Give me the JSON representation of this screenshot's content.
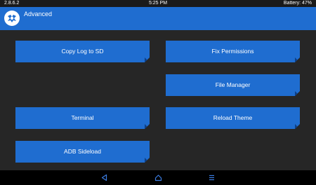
{
  "status": {
    "version": "2.8.6.2",
    "time": "5:25 PM",
    "battery": "Battery: 47%"
  },
  "header": {
    "title": "Advanced",
    "logo_icon": "twrp-logo-icon"
  },
  "buttons": {
    "copy_log": "Copy Log to SD",
    "fix_permissions": "Fix Permissions",
    "file_manager": "File Manager",
    "terminal": "Terminal",
    "reload_theme": "Reload Theme",
    "adb_sideload": "ADB Sideload"
  },
  "nav": {
    "back_icon": "back-icon",
    "home_icon": "home-icon",
    "menu_icon": "menu-icon"
  },
  "colors": {
    "accent": "#1f6dd0",
    "background": "#262626",
    "nav_icons": "#3a7be0"
  }
}
